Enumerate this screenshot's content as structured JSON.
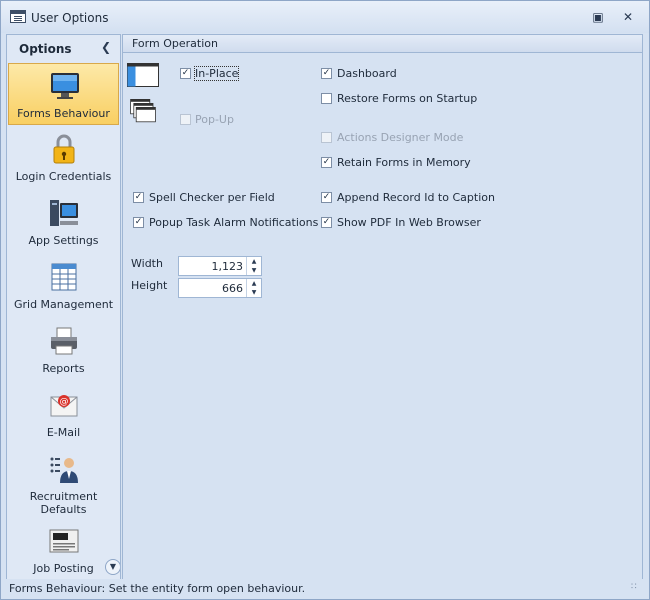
{
  "window": {
    "title": "User Options",
    "restore_icon": "restore-icon",
    "close_icon": "close-icon"
  },
  "sidebar": {
    "title": "Options",
    "items": [
      {
        "label": "Forms Behaviour",
        "icon": "monitor-icon",
        "active": true
      },
      {
        "label": "Login Credentials",
        "icon": "padlock-icon",
        "active": false
      },
      {
        "label": "App Settings",
        "icon": "computer-icon",
        "active": false
      },
      {
        "label": "Grid Management",
        "icon": "grid-icon",
        "active": false
      },
      {
        "label": "Reports",
        "icon": "printer-icon",
        "active": false
      },
      {
        "label": "E-Mail",
        "icon": "email-icon",
        "active": false
      },
      {
        "label": "Recruitment Defaults",
        "icon": "recruiter-icon",
        "active": false
      },
      {
        "label": "Job Posting",
        "icon": "newspaper-icon",
        "active": false
      }
    ]
  },
  "panel": {
    "title": "Form Operation",
    "in_place": {
      "label": "In-Place",
      "checked": true
    },
    "pop_up": {
      "label": "Pop-Up",
      "checked": false,
      "disabled": true
    },
    "dashboard": {
      "label": "Dashboard",
      "checked": true
    },
    "restore_forms": {
      "label": "Restore Forms on Startup",
      "checked": false
    },
    "actions_designer": {
      "label": "Actions Designer Mode",
      "checked": false,
      "disabled": true
    },
    "retain_forms": {
      "label": "Retain Forms in Memory",
      "checked": true
    },
    "spell_checker": {
      "label": "Spell Checker per Field",
      "checked": true
    },
    "popup_alarm": {
      "label": "Popup Task Alarm Notifications",
      "checked": true
    },
    "append_record": {
      "label": "Append Record Id to Caption",
      "checked": true
    },
    "show_pdf": {
      "label": "Show PDF In Web Browser",
      "checked": true
    },
    "width": {
      "label": "Width",
      "value": "1,123"
    },
    "height": {
      "label": "Height",
      "value": "666"
    }
  },
  "status": {
    "text": "Forms Behaviour: Set the entity form open behaviour."
  },
  "colors": {
    "active_item": "#f9cf62",
    "frame": "#8ea6c7",
    "background": "#d6e2f2"
  }
}
